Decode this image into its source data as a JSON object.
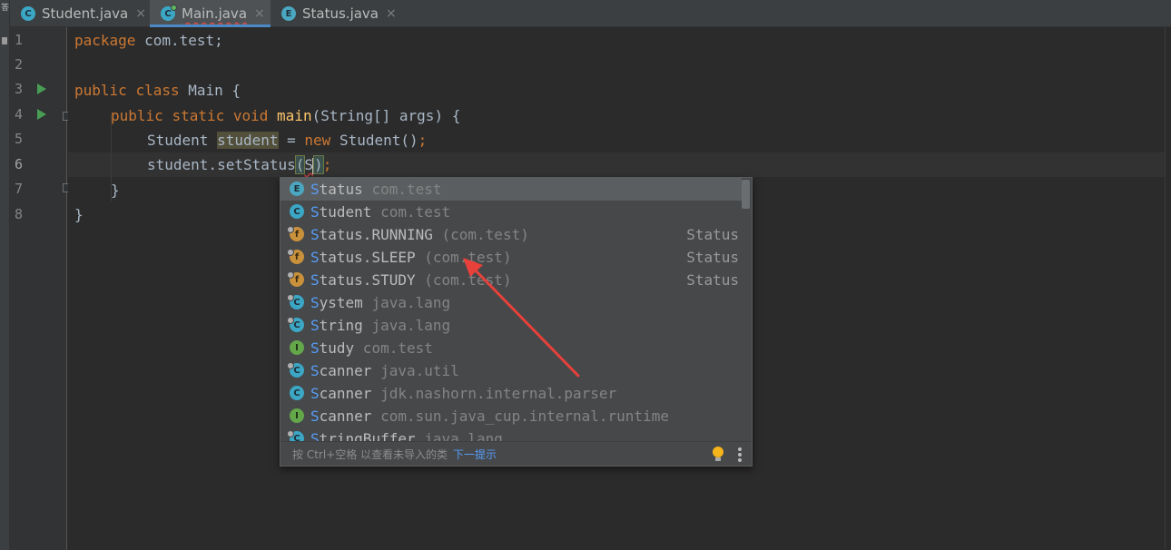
{
  "toolstrip": {
    "glyph": "答"
  },
  "tabs": [
    {
      "name": "Student.java",
      "icon": "class-icon",
      "letter": "C",
      "active": false
    },
    {
      "name": "Main.java",
      "icon": "class-run-icon",
      "letter": "C",
      "active": true
    },
    {
      "name": "Status.java",
      "icon": "enum-icon",
      "letter": "E",
      "active": false
    }
  ],
  "close_glyph": "×",
  "gutter": {
    "line_numbers": [
      "1",
      "2",
      "3",
      "4",
      "5",
      "6",
      "7",
      "8"
    ]
  },
  "code": {
    "line1": {
      "kw": "package",
      "rest": " com.test;"
    },
    "line3": {
      "kw1": "public",
      "kw2": "class",
      "rest": " Main {"
    },
    "line4": {
      "kw1": "public",
      "kw2": "static",
      "kw3": "void",
      "fn": "main",
      "rest": "(String[] args) {"
    },
    "line5": {
      "type": "Student ",
      "var": "student",
      "eq": " = ",
      "kw": "new",
      "rest": " Student()",
      "semi": ";"
    },
    "line6": {
      "call": "student.setStatus",
      "open": "(",
      "typed": "S",
      "close": ")",
      "semi": ";"
    },
    "line7": {
      "text": "}"
    },
    "line8": {
      "text": "}"
    }
  },
  "popup": {
    "items": [
      {
        "icon": "enum-icon",
        "letter": "E",
        "kind": "e",
        "match": "S",
        "name": "tatus",
        "pkg": " com.test",
        "type": "",
        "locked": false
      },
      {
        "icon": "class-icon",
        "letter": "C",
        "kind": "c",
        "match": "S",
        "name": "tudent",
        "pkg": " com.test",
        "type": "",
        "locked": false
      },
      {
        "icon": "field-icon",
        "letter": "f",
        "kind": "f",
        "match": "S",
        "name": "tatus.RUNNING",
        "pkg": " (com.test)",
        "type": "Status",
        "locked": true
      },
      {
        "icon": "field-icon",
        "letter": "f",
        "kind": "f",
        "match": "S",
        "name": "tatus.SLEEP",
        "pkg": " (com.test)",
        "type": "Status",
        "locked": true
      },
      {
        "icon": "field-icon",
        "letter": "f",
        "kind": "f",
        "match": "S",
        "name": "tatus.STUDY",
        "pkg": " (com.test)",
        "type": "Status",
        "locked": true
      },
      {
        "icon": "class-icon",
        "letter": "C",
        "kind": "c",
        "match": "S",
        "name": "ystem",
        "pkg": " java.lang",
        "type": "",
        "locked": true
      },
      {
        "icon": "class-icon",
        "letter": "C",
        "kind": "c",
        "match": "S",
        "name": "tring",
        "pkg": " java.lang",
        "type": "",
        "locked": true
      },
      {
        "icon": "interface-icon",
        "letter": "I",
        "kind": "i",
        "match": "S",
        "name": "tudy",
        "pkg": " com.test",
        "type": "",
        "locked": false
      },
      {
        "icon": "class-icon",
        "letter": "C",
        "kind": "c",
        "match": "S",
        "name": "canner",
        "pkg": " java.util",
        "type": "",
        "locked": true
      },
      {
        "icon": "class-icon",
        "letter": "C",
        "kind": "c",
        "match": "S",
        "name": "canner",
        "pkg": " jdk.nashorn.internal.parser",
        "type": "",
        "locked": false
      },
      {
        "icon": "interface-icon",
        "letter": "I",
        "kind": "i",
        "match": "S",
        "name": "canner",
        "pkg": " com.sun.java_cup.internal.runtime",
        "type": "",
        "locked": false
      },
      {
        "icon": "class-icon",
        "letter": "C",
        "kind": "c",
        "match": "S",
        "name": "tringBuffer",
        "pkg": " java.lang",
        "type": "",
        "locked": true
      }
    ],
    "selected_index": 0,
    "footer": {
      "hint": "按 Ctrl+空格 以查看未导入的类",
      "link": "下一提示"
    }
  },
  "colors": {
    "annotation_arrow": "#e8403a",
    "accent": "#4a88c7"
  }
}
